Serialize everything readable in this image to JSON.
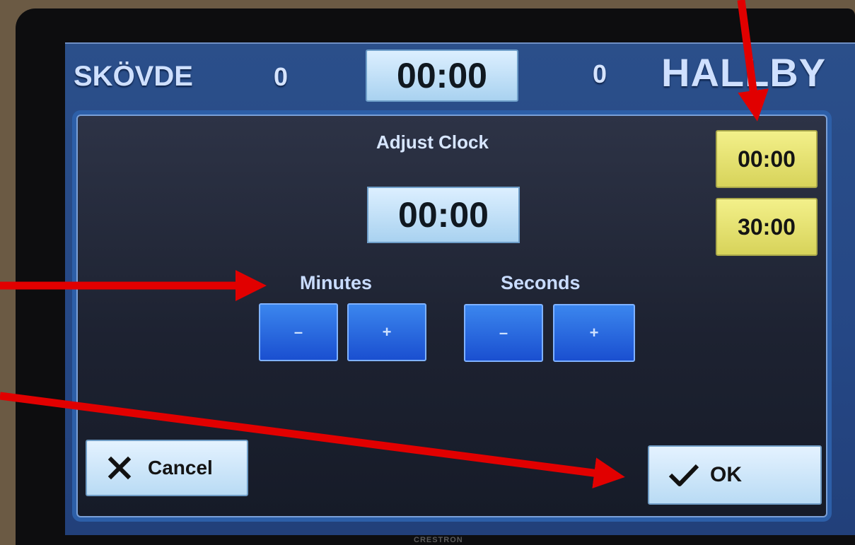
{
  "device": {
    "brand": "CRESTRON"
  },
  "scoreboard": {
    "home_team": "SKÖVDE",
    "home_score": "0",
    "clock": "00:00",
    "away_score": "0",
    "away_team": "HALLBY"
  },
  "dialog": {
    "title": "Adjust Clock",
    "clock_value": "00:00",
    "presets": [
      "00:00",
      "30:00"
    ],
    "minutes_label": "Minutes",
    "seconds_label": "Seconds",
    "minus_label": "–",
    "plus_label": "+",
    "cancel_label": "Cancel",
    "ok_label": "OK"
  },
  "colors": {
    "annotation_arrow": "#e10000",
    "preset_button": "#e6e26f",
    "adjust_button": "#2a68e0",
    "screen_background": "#254785"
  },
  "icons": {
    "cancel": "x-icon",
    "ok": "checkmark-icon"
  }
}
